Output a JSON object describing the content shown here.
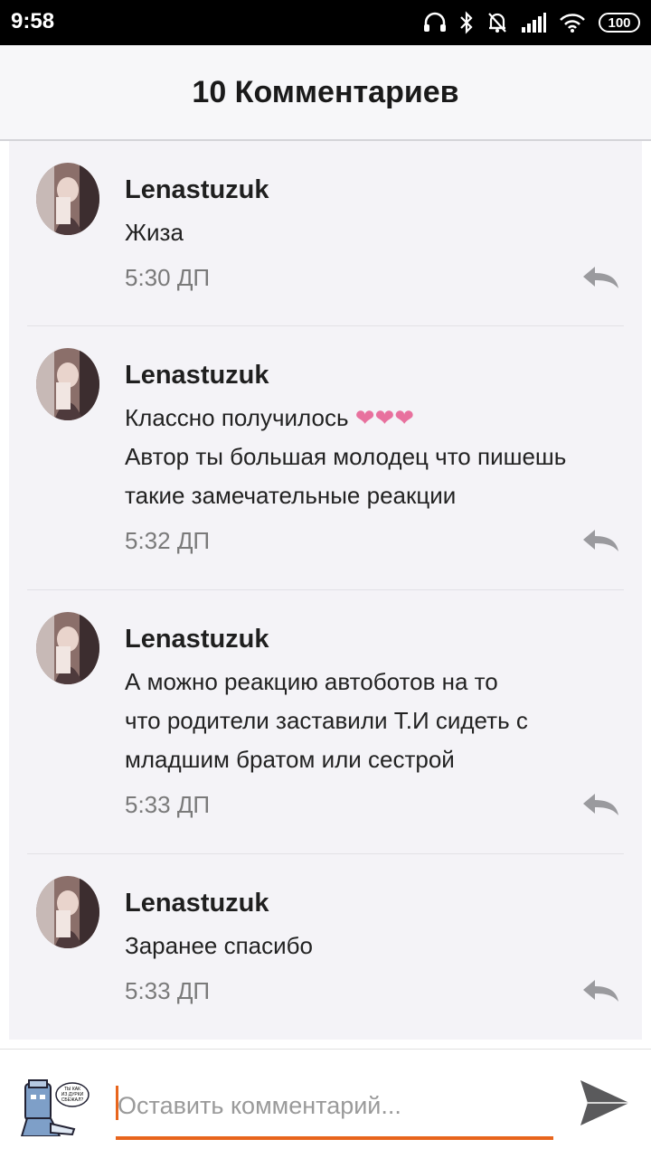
{
  "status_bar": {
    "time": "9:58",
    "battery": "100",
    "icons": [
      "headphones-icon",
      "bluetooth-icon",
      "mute-bell-icon",
      "signal-icon",
      "wifi-icon",
      "battery-icon"
    ]
  },
  "header": {
    "title": "10 Комментариев"
  },
  "comments": [
    {
      "author": "Lenastuzuk",
      "lines": [
        "Жиза"
      ],
      "time": "5:30 ДП"
    },
    {
      "author": "Lenastuzuk",
      "lines": [
        "Классно получилось",
        "Автор ты большая молодец что пишешь",
        "такие замечательные реакции"
      ],
      "hearts": "❤❤❤",
      "time": "5:32 ДП"
    },
    {
      "author": "Lenastuzuk",
      "lines": [
        "А можно реакцию автоботов на то",
        "что родители заставили Т.И сидеть с",
        "младшим братом или сестрой"
      ],
      "time": "5:33 ДП"
    },
    {
      "author": "Lenastuzuk",
      "lines": [
        "Заранее спасибо"
      ],
      "time": "5:33 ДП"
    }
  ],
  "input": {
    "placeholder": "Оставить комментарий...",
    "avatar_caption": "ТЫ КАК ИЗ ДУРКИ СБЕЖАЛ?"
  },
  "colors": {
    "accent": "#e8651d",
    "heart": "#e8719e",
    "list_background": "#f4f3f7"
  }
}
